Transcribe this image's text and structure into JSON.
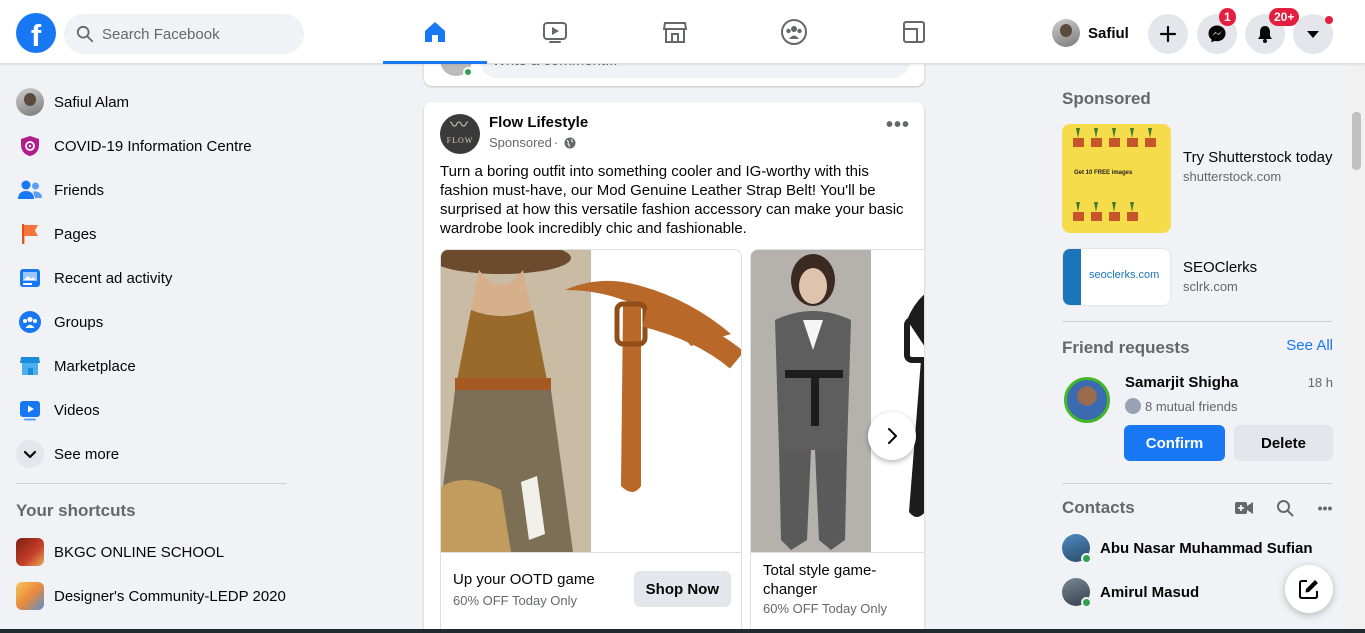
{
  "colors": {
    "brand": "#1877f2",
    "badge": "#e41e3f",
    "online": "#31a24c"
  },
  "header": {
    "logo_icon": "facebook-f-icon",
    "search_placeholder": "Search Facebook",
    "tabs": [
      {
        "name": "home",
        "icon": "home-icon",
        "active": true
      },
      {
        "name": "watch",
        "icon": "video-icon",
        "active": false
      },
      {
        "name": "marketplace",
        "icon": "store-icon",
        "active": false
      },
      {
        "name": "groups",
        "icon": "groups-icon",
        "active": false
      },
      {
        "name": "gaming",
        "icon": "gaming-icon",
        "active": false
      }
    ],
    "profile_name": "Safiul",
    "messenger_badge": "1",
    "notifications_badge": "20+"
  },
  "sidebar": {
    "items": [
      {
        "label": "Safiul Alam",
        "icon": "avatar"
      },
      {
        "label": "COVID-19 Information Centre",
        "icon": "covid-shield-icon"
      },
      {
        "label": "Friends",
        "icon": "friends-icon"
      },
      {
        "label": "Pages",
        "icon": "flag-icon"
      },
      {
        "label": "Recent ad activity",
        "icon": "ad-activity-icon"
      },
      {
        "label": "Groups",
        "icon": "groups-icon"
      },
      {
        "label": "Marketplace",
        "icon": "store-icon"
      },
      {
        "label": "Videos",
        "icon": "video-icon"
      },
      {
        "label": "See more",
        "icon": "chevron-down-icon"
      }
    ],
    "shortcuts_title": "Your shortcuts",
    "shortcuts": [
      {
        "label": "BKGC ONLINE SCHOOL"
      },
      {
        "label": "Designer's Community-LEDP 2020"
      }
    ]
  },
  "feed": {
    "comment_placeholder": "Write a comment...",
    "post": {
      "page_name": "Flow Lifestyle",
      "sponsored": "Sponsored",
      "avatar_text": "FLOW",
      "text": "Turn a boring outfit into something cooler and IG-worthy with this fashion must-have, our Mod Genuine Leather Strap Belt! You'll be surprised at how this versatile fashion accessory can make your basic wardrobe look incredibly chic and fashionable.",
      "carousel": [
        {
          "title": "Up your OOTD game",
          "subtitle": "60% OFF Today Only",
          "cta": "Shop Now"
        },
        {
          "title": "Total style game-changer",
          "subtitle": "60% OFF Today Only"
        }
      ]
    }
  },
  "right": {
    "sponsored_title": "Sponsored",
    "ads": [
      {
        "title": "Try Shutterstock today",
        "url": "shutterstock.com",
        "img_text": "Get 10 FREE images"
      },
      {
        "title": "SEOClerks",
        "url": "sclrk.com",
        "img_text": "seoclerks.com"
      }
    ],
    "friend_requests_title": "Friend requests",
    "see_all": "See All",
    "request": {
      "name": "Samarjit Shigha",
      "time": "18 h",
      "mutual": "8 mutual friends",
      "confirm": "Confirm",
      "delete": "Delete"
    },
    "contacts_title": "Contacts",
    "contacts": [
      {
        "name": "Abu Nasar Muhammad Sufian"
      },
      {
        "name": "Amirul Masud"
      }
    ]
  }
}
